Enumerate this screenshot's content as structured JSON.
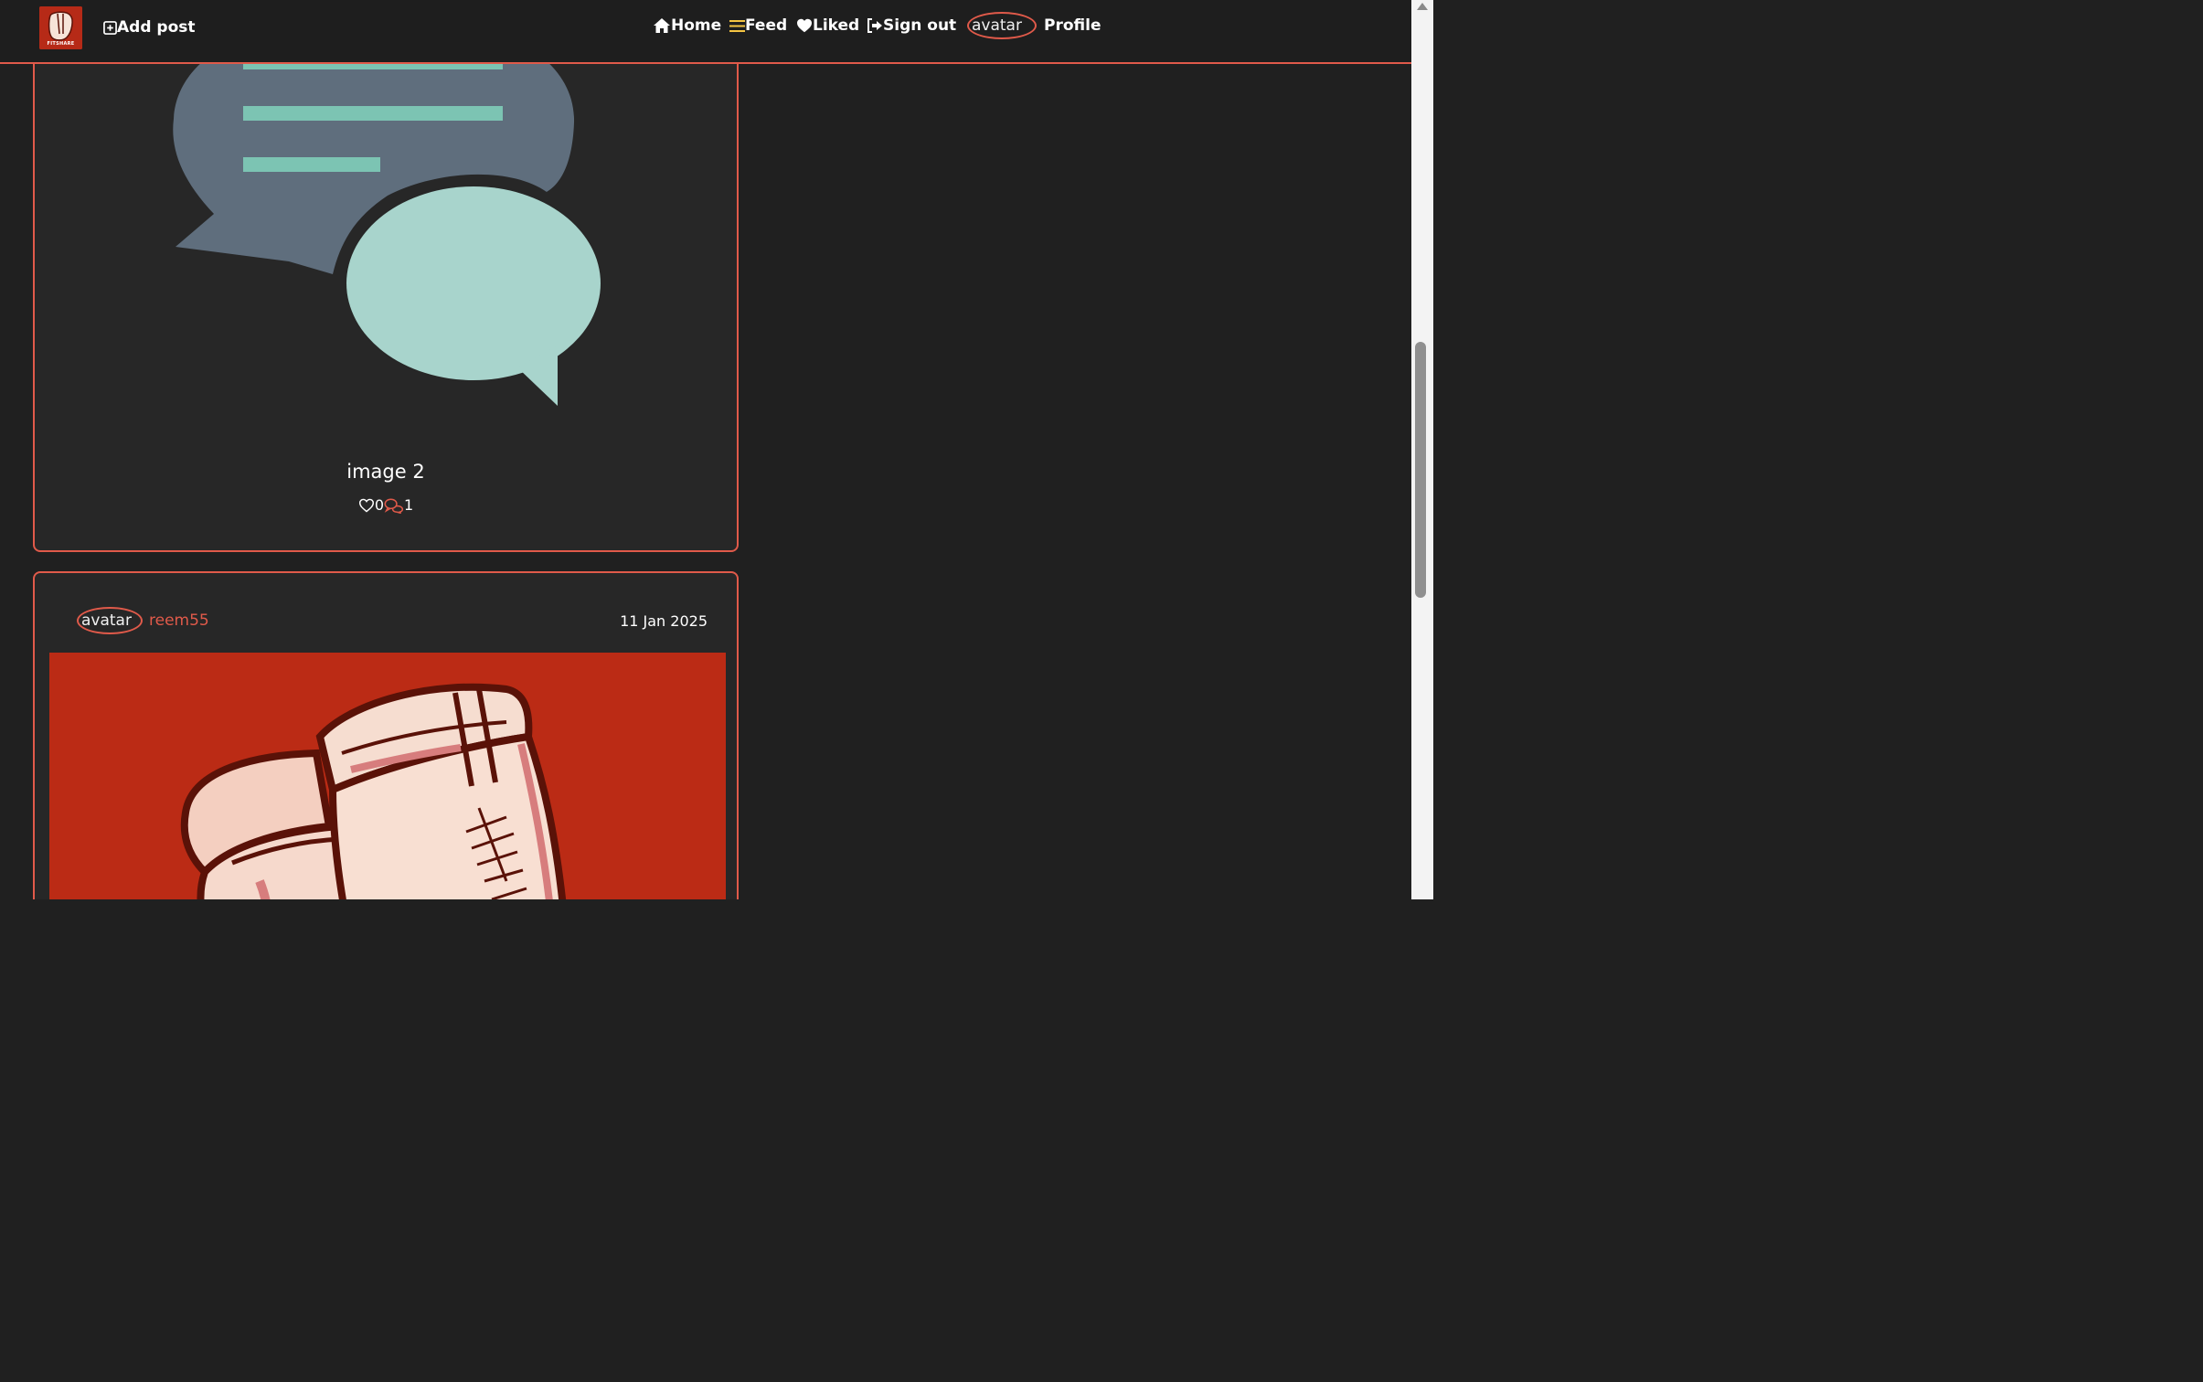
{
  "colors": {
    "accent": "#e05a4a",
    "background": "#202020",
    "card_background": "#272727",
    "feed_icon": "#f5c542",
    "image_red": "#bb2b15"
  },
  "navbar": {
    "logo_text": "FITSHARE",
    "add_post_label": "Add post",
    "home_label": "Home",
    "feed_label": "Feed",
    "liked_label": "Liked",
    "signout_label": "Sign out",
    "avatar_alt": "avatar",
    "profile_label": "Profile"
  },
  "posts": [
    {
      "caption": "image 2",
      "likes": "0",
      "comments": "1",
      "image": "chat-bubbles-illustration"
    },
    {
      "author_avatar_alt": "avatar",
      "author": "reem55",
      "date": "11 Jan 2025",
      "image": "boxing-gloves-illustration"
    }
  ]
}
